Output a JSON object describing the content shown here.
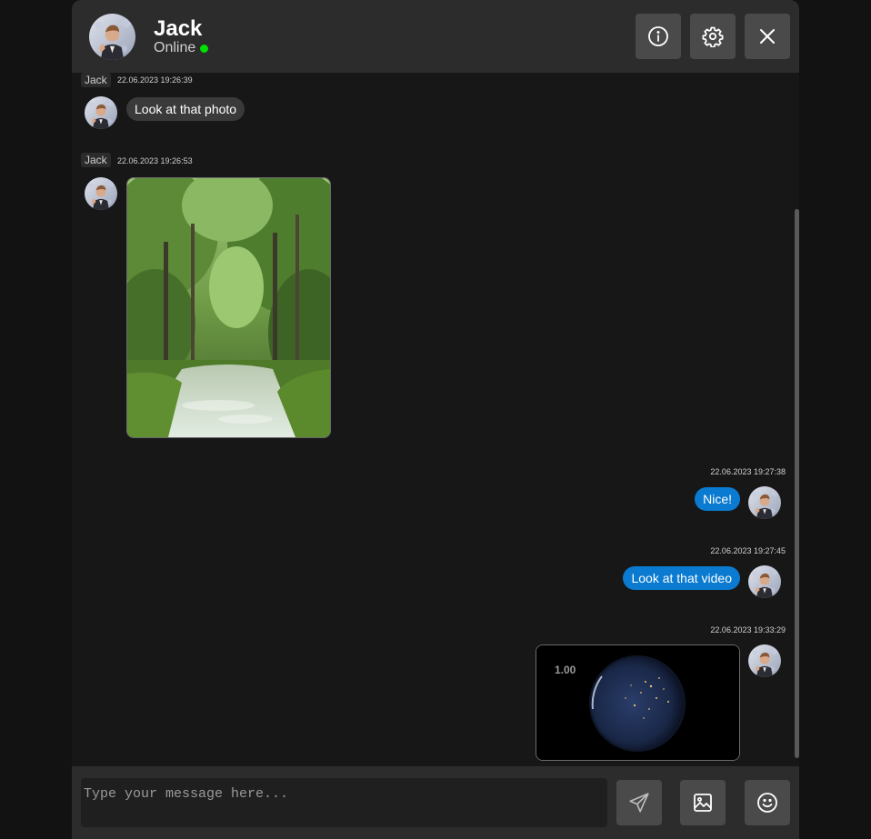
{
  "header": {
    "name": "Jack",
    "status": "Online",
    "status_color": "#00e000",
    "buttons": [
      {
        "icon": "info-icon"
      },
      {
        "icon": "gear-icon"
      },
      {
        "icon": "close-icon"
      }
    ]
  },
  "messages": [
    {
      "direction": "incoming",
      "sender": "Jack",
      "timestamp": "22.06.2023 19:26:39",
      "type": "text",
      "text": "Look at that photo"
    },
    {
      "direction": "incoming",
      "sender": "Jack",
      "timestamp": "22.06.2023 19:26:53",
      "type": "image",
      "image": "forest-stream-photo"
    },
    {
      "direction": "outgoing",
      "timestamp": "22.06.2023 19:27:38",
      "type": "text",
      "text": "Nice!"
    },
    {
      "direction": "outgoing",
      "timestamp": "22.06.2023 19:27:45",
      "type": "text",
      "text": "Look at that video"
    },
    {
      "direction": "outgoing",
      "timestamp": "22.06.2023 19:33:29",
      "type": "video",
      "video": "earth-at-night-video",
      "rate": "1.00"
    }
  ],
  "composer": {
    "placeholder": "Type your message here...",
    "value": "",
    "buttons": [
      {
        "icon": "send-icon"
      },
      {
        "icon": "image-icon"
      },
      {
        "icon": "emoji-icon"
      }
    ]
  },
  "colors": {
    "outgoing_bubble": "#0a7bd1",
    "incoming_bubble": "#3a3a3a",
    "header_bg": "#2c2c2c",
    "chat_bg": "#171717"
  }
}
